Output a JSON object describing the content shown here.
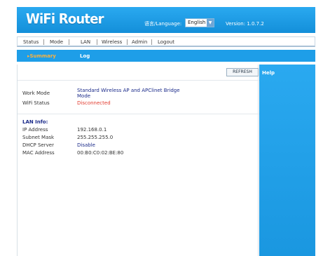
{
  "header": {
    "logo": "WiFi Router",
    "language_label": "语言/Language:",
    "language_value": "English",
    "version": "Version: 1.0.7.2"
  },
  "topnav": {
    "items": [
      "Status",
      "Mode",
      "LAN",
      "Wireless",
      "Admin",
      "Logout"
    ],
    "separator": "|"
  },
  "subnav": {
    "summary": "▸Summary",
    "log": "Log"
  },
  "main": {
    "refresh_label": "REFRESH",
    "work_mode_label": "Work Mode",
    "work_mode_value_line1": "Standard Wireless AP and APClinet Bridge",
    "work_mode_value_line2": "Mode",
    "wifi_status_label": "WiFi Status",
    "wifi_status_value": "Disconnected",
    "lan_info_heading": "LAN Info:",
    "ip_label": "IP Address",
    "ip_value": "192.168.0.1",
    "mask_label": "Subnet Mask",
    "mask_value": "255.255.255.0",
    "dhcp_label": "DHCP Server",
    "dhcp_value": "Disable",
    "mac_label": "MAC Address",
    "mac_value": "00:B0:C0:02:BE:80"
  },
  "help": {
    "title": "Help"
  },
  "colors": {
    "accent_blue": "#1e9ee8",
    "summary_orange": "#ffb23b",
    "disconnected_red": "#e23b2e",
    "value_blue": "#1b2b8a"
  }
}
